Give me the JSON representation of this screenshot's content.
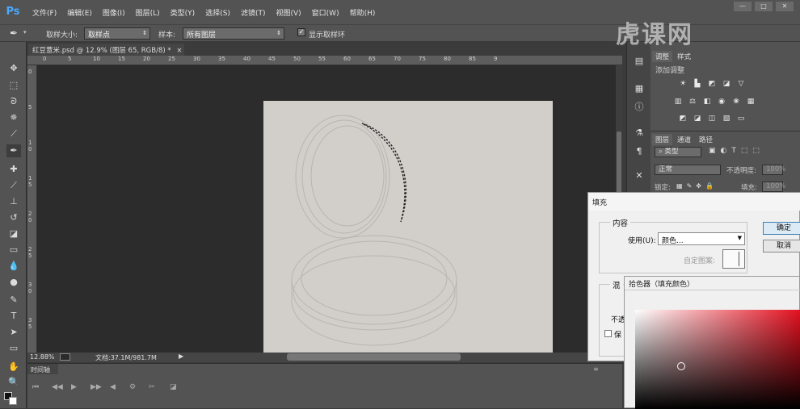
{
  "app": {
    "logo": "Ps"
  },
  "menu": [
    "文件(F)",
    "编辑(E)",
    "图像(I)",
    "图层(L)",
    "类型(Y)",
    "选择(S)",
    "滤镜(T)",
    "视图(V)",
    "窗口(W)",
    "帮助(H)"
  ],
  "window_buttons": [
    "—",
    "□",
    "✕"
  ],
  "options": {
    "sample_size_label": "取样大小:",
    "sample_size_value": "取样点",
    "sample_label": "样本:",
    "sample_value": "所有图层",
    "show_ring_label": "显示取样环",
    "show_ring_checked": "✓"
  },
  "document": {
    "tab": "红豆薏米.psd @ 12.9% (图层 65, RGB/8) *",
    "close": "×"
  },
  "ruler_top": [
    "0",
    "5",
    "10",
    "15",
    "20",
    "25",
    "30",
    "35",
    "40",
    "45",
    "50",
    "55",
    "60",
    "65",
    "70",
    "75",
    "80",
    "85",
    "9"
  ],
  "ruler_left": [
    "0",
    "5",
    "1 0",
    "1 5",
    "2 0",
    "2 5",
    "3 0",
    "3 5"
  ],
  "status": {
    "zoom": "12.88%",
    "doc_info": "文档:37.1M/981.7M"
  },
  "timeline": {
    "tab": "时间轴"
  },
  "panels": {
    "adjust_tabs": [
      "调整",
      "样式"
    ],
    "adjust_heading": "添加调整",
    "layer_tabs": [
      "图层",
      "通道",
      "路径"
    ],
    "filter_kind": "类型",
    "blend_mode": "正常",
    "opacity_label": "不透明度:",
    "opacity_value": "100%",
    "lock_label": "锁定:",
    "fill_label": "填充:",
    "fill_value": "100%"
  },
  "fill_dialog": {
    "title": "填充",
    "contents_group": "内容",
    "use_label": "使用(U):",
    "use_value": "颜色...",
    "custom_pattern_label": "自定图案:",
    "blend_group_partial": "混",
    "opacity_partial": "不透",
    "preserve_partial": "保",
    "ok": "确定",
    "cancel": "取消"
  },
  "color_picker": {
    "title": "拾色器（填充颜色）"
  },
  "watermark": "虎课网",
  "colors": {
    "accent_ps": "#4aa8ff",
    "picker_hue": "#e4101f",
    "canvas": "#d2cfcb"
  }
}
